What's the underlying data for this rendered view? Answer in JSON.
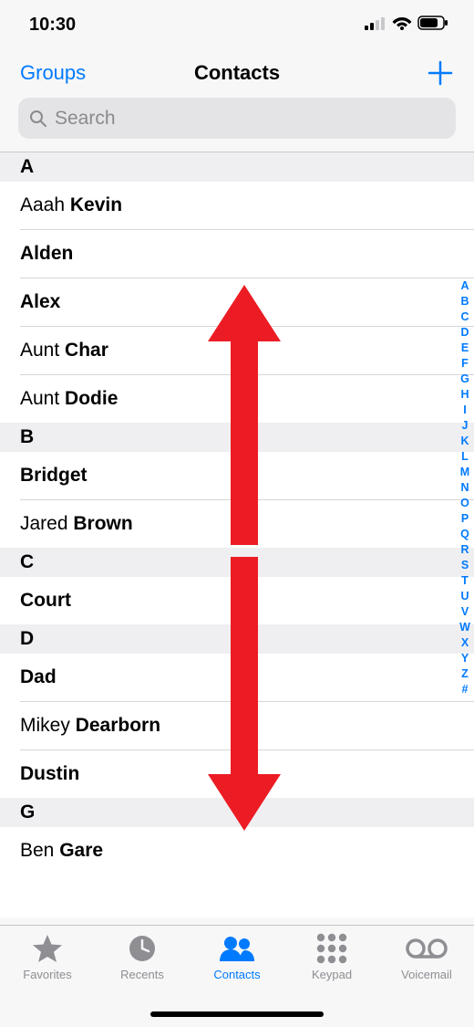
{
  "status_bar": {
    "time": "10:30"
  },
  "nav": {
    "left": "Groups",
    "title": "Contacts"
  },
  "search": {
    "placeholder": "Search"
  },
  "sections": [
    {
      "letter": "A",
      "contacts": [
        {
          "first": "Aaah",
          "last": "Kevin"
        },
        {
          "first": "Alden",
          "last": ""
        },
        {
          "first": "Alex",
          "last": ""
        },
        {
          "first": "Aunt",
          "last": "Char"
        },
        {
          "first": "Aunt",
          "last": "Dodie"
        }
      ]
    },
    {
      "letter": "B",
      "contacts": [
        {
          "first": "Bridget",
          "last": ""
        },
        {
          "first": "Jared",
          "last": "Brown"
        }
      ]
    },
    {
      "letter": "C",
      "contacts": [
        {
          "first": "Court",
          "last": ""
        }
      ]
    },
    {
      "letter": "D",
      "contacts": [
        {
          "first": "Dad",
          "last": ""
        },
        {
          "first": "Mikey",
          "last": "Dearborn"
        },
        {
          "first": "Dustin",
          "last": ""
        }
      ]
    },
    {
      "letter": "G",
      "contacts": [
        {
          "first": "Ben",
          "last": "Gare"
        }
      ]
    }
  ],
  "index_letters": [
    "A",
    "B",
    "C",
    "D",
    "E",
    "F",
    "G",
    "H",
    "I",
    "J",
    "K",
    "L",
    "M",
    "N",
    "O",
    "P",
    "Q",
    "R",
    "S",
    "T",
    "U",
    "V",
    "W",
    "X",
    "Y",
    "Z",
    "#"
  ],
  "tabs": [
    {
      "id": "favorites",
      "label": "Favorites",
      "active": false
    },
    {
      "id": "recents",
      "label": "Recents",
      "active": false
    },
    {
      "id": "contacts",
      "label": "Contacts",
      "active": true
    },
    {
      "id": "keypad",
      "label": "Keypad",
      "active": false
    },
    {
      "id": "voicemail",
      "label": "Voicemail",
      "active": false
    }
  ],
  "colors": {
    "accent": "#007aff",
    "inactive": "#8e8e93",
    "annotation": "#ec1c24"
  }
}
